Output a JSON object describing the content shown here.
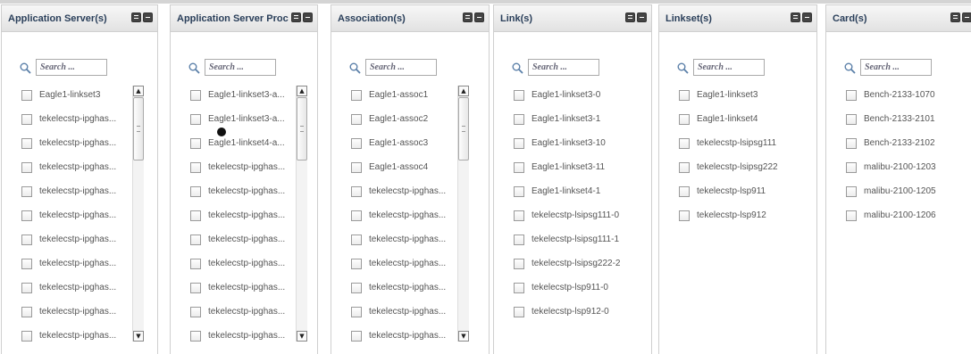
{
  "search": {
    "placeholder": "Search ..."
  },
  "panels": [
    {
      "title": "Application Server(s)",
      "items": [
        "Eagle1-linkset3",
        "tekelecstp-ipghas...",
        "tekelecstp-ipghas...",
        "tekelecstp-ipghas...",
        "tekelecstp-ipghas...",
        "tekelecstp-ipghas...",
        "tekelecstp-ipghas...",
        "tekelecstp-ipghas...",
        "tekelecstp-ipghas...",
        "tekelecstp-ipghas...",
        "tekelecstp-ipghas..."
      ],
      "scroll": {
        "up": "▲",
        "down": "▼"
      }
    },
    {
      "title": "Application Server Proc",
      "items": [
        "Eagle1-linkset3-a...",
        "Eagle1-linkset3-a...",
        "Eagle1-linkset4-a...",
        "tekelecstp-ipghas...",
        "tekelecstp-ipghas...",
        "tekelecstp-ipghas...",
        "tekelecstp-ipghas...",
        "tekelecstp-ipghas...",
        "tekelecstp-ipghas...",
        "tekelecstp-ipghas...",
        "tekelecstp-ipghas..."
      ],
      "scroll": {
        "up": "▲",
        "down": "▼"
      }
    },
    {
      "title": "Association(s)",
      "items": [
        "Eagle1-assoc1",
        "Eagle1-assoc2",
        "Eagle1-assoc3",
        "Eagle1-assoc4",
        "tekelecstp-ipghas...",
        "tekelecstp-ipghas...",
        "tekelecstp-ipghas...",
        "tekelecstp-ipghas...",
        "tekelecstp-ipghas...",
        "tekelecstp-ipghas...",
        "tekelecstp-ipghas..."
      ],
      "scroll": {
        "up": "▲",
        "down": "▼"
      }
    },
    {
      "title": "Link(s)",
      "items": [
        "Eagle1-linkset3-0",
        "Eagle1-linkset3-1",
        "Eagle1-linkset3-10",
        "Eagle1-linkset3-11",
        "Eagle1-linkset4-1",
        "tekelecstp-lsipsg111-0",
        "tekelecstp-lsipsg111-1",
        "tekelecstp-lsipsg222-2",
        "tekelecstp-lsp911-0",
        "tekelecstp-lsp912-0"
      ]
    },
    {
      "title": "Linkset(s)",
      "items": [
        "Eagle1-linkset3",
        "Eagle1-linkset4",
        "tekelecstp-lsipsg111",
        "tekelecstp-lsipsg222",
        "tekelecstp-lsp911",
        "tekelecstp-lsp912"
      ]
    },
    {
      "title": "Card(s)",
      "items": [
        "Bench-2133-1070",
        "Bench-2133-2101",
        "Bench-2133-2102",
        "malibu-2100-1203",
        "malibu-2100-1205",
        "malibu-2100-1206"
      ]
    }
  ]
}
